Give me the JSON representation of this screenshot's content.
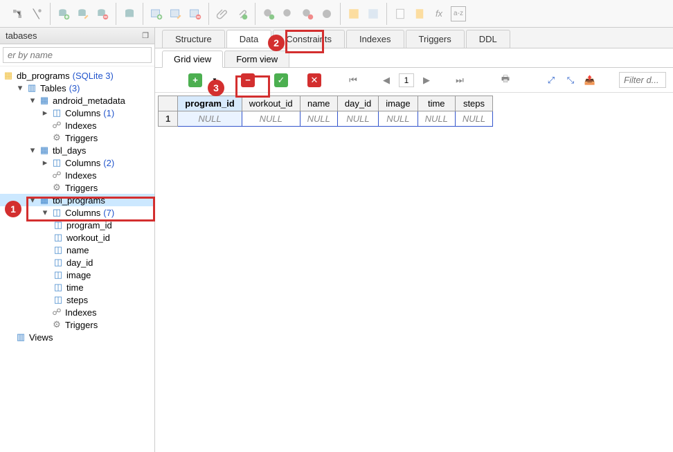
{
  "sidebar": {
    "title": "tabases",
    "filter_placeholder": "er by name",
    "db_name": "db_programs",
    "db_engine": "(SQLite 3)",
    "tables_label": "Tables",
    "tables_count": "(3)",
    "t1": {
      "name": "android_metadata",
      "cols_label": "Columns",
      "cols_count": "(1)",
      "idx": "Indexes",
      "trg": "Triggers"
    },
    "t2": {
      "name": "tbl_days",
      "cols_label": "Columns",
      "cols_count": "(2)",
      "idx": "Indexes",
      "trg": "Triggers"
    },
    "t3": {
      "name": "tbl_programs",
      "cols_label": "Columns",
      "cols_count": "(7)",
      "idx": "Indexes",
      "trg": "Triggers",
      "c": [
        "program_id",
        "workout_id",
        "name",
        "day_id",
        "image",
        "time",
        "steps"
      ]
    },
    "views_label": "Views"
  },
  "tabs": {
    "structure": "Structure",
    "data": "Data",
    "constraints": "Constraints",
    "indexes": "Indexes",
    "triggers": "Triggers",
    "ddl": "DDL"
  },
  "subtabs": {
    "grid": "Grid view",
    "form": "Form view"
  },
  "toolbar": {
    "page": "1",
    "filter_placeholder": "Filter d...",
    "fx": "fx",
    "az": "a-z"
  },
  "grid": {
    "headers": [
      "program_id",
      "workout_id",
      "name",
      "day_id",
      "image",
      "time",
      "steps"
    ],
    "rownum": "1",
    "null": "NULL"
  },
  "callouts": {
    "c1": "1",
    "c2": "2",
    "c3": "3"
  }
}
